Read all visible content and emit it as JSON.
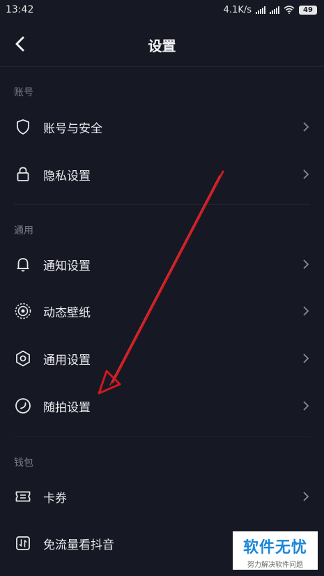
{
  "status_bar": {
    "time": "13:42",
    "speed": "4.1K/s",
    "battery": "49"
  },
  "header": {
    "title": "设置"
  },
  "sections": [
    {
      "title": "账号",
      "items": [
        {
          "label": "账号与安全",
          "icon": "shield-icon"
        },
        {
          "label": "隐私设置",
          "icon": "lock-icon"
        }
      ]
    },
    {
      "title": "通用",
      "items": [
        {
          "label": "通知设置",
          "icon": "bell-icon"
        },
        {
          "label": "动态壁纸",
          "icon": "live-wallpaper-icon"
        },
        {
          "label": "通用设置",
          "icon": "gear-icon"
        },
        {
          "label": "随拍设置",
          "icon": "snapshot-icon"
        }
      ]
    },
    {
      "title": "钱包",
      "items": [
        {
          "label": "卡券",
          "icon": "coupon-icon"
        },
        {
          "label": "免流量看抖音",
          "icon": "data-free-icon"
        }
      ]
    }
  ],
  "watermark": {
    "title": "软件无忧",
    "subtitle": "努力解决软件问题"
  },
  "colors": {
    "background": "#161823",
    "annotation_arrow": "#d0191f",
    "watermark_blue": "#1a86d8"
  }
}
